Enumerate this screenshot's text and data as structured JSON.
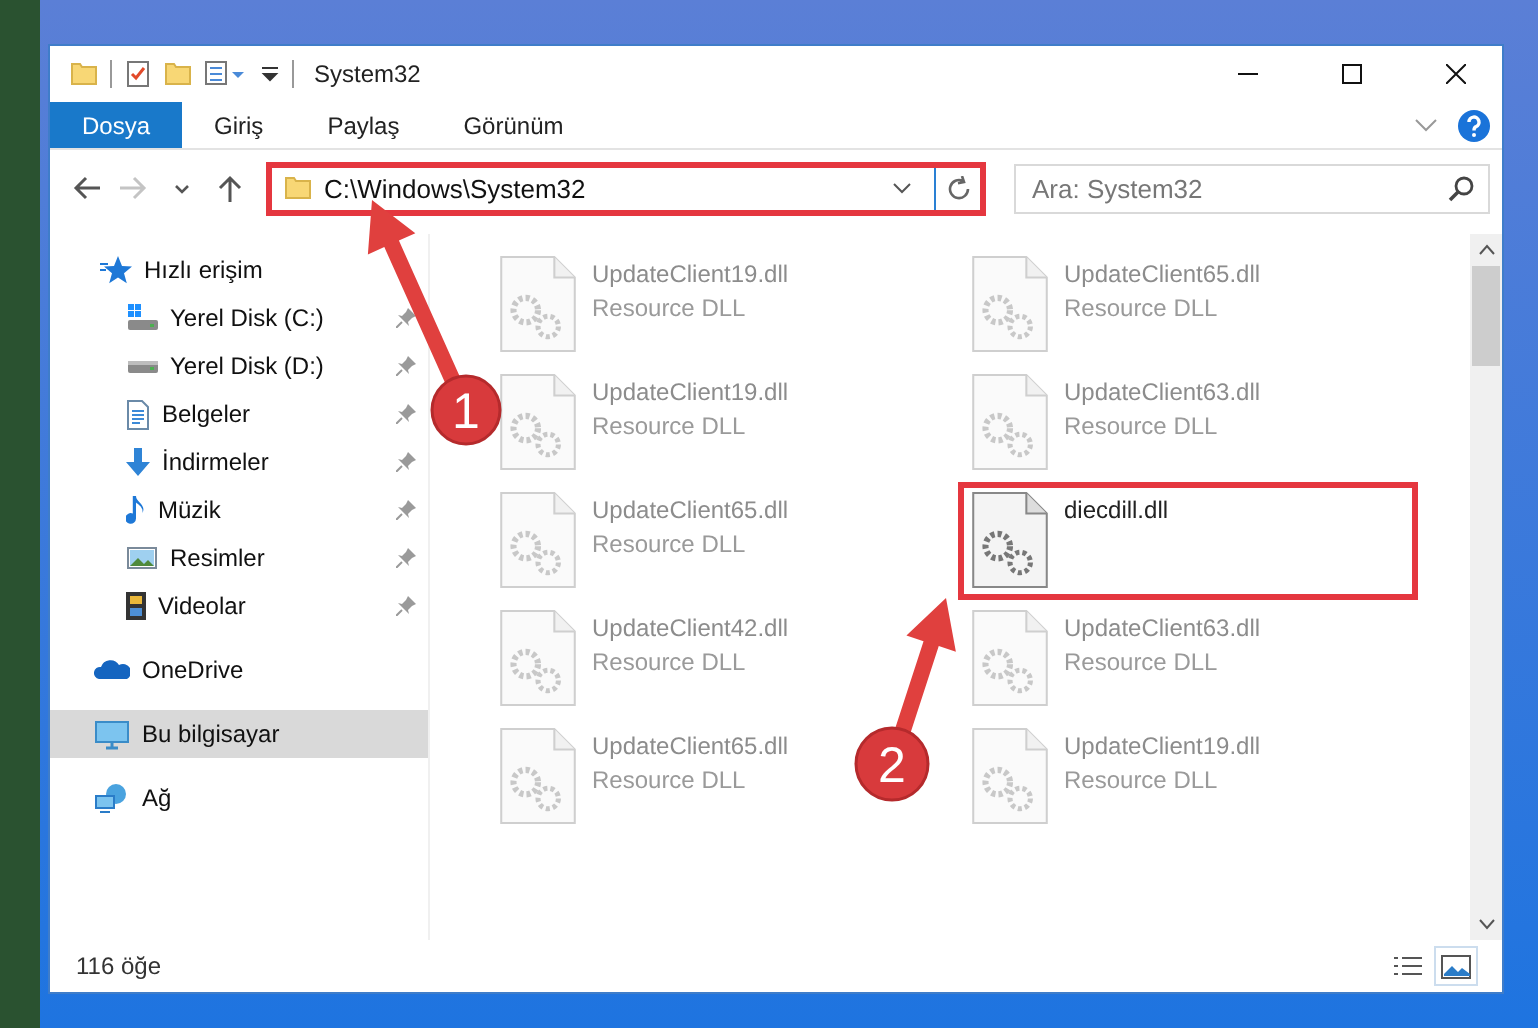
{
  "window": {
    "title": "System32"
  },
  "ribbon": {
    "tabs": [
      {
        "label": "Dosya",
        "selected": true
      },
      {
        "label": "Giriş",
        "selected": false
      },
      {
        "label": "Paylaş",
        "selected": false
      },
      {
        "label": "Görünüm",
        "selected": false
      }
    ]
  },
  "navigation": {
    "buttons": [
      {
        "kind": "back",
        "disabled": false
      },
      {
        "kind": "forward",
        "disabled": true
      },
      {
        "kind": "recent",
        "disabled": false
      },
      {
        "kind": "up",
        "disabled": false
      }
    ],
    "address": "C:\\Windows\\System32",
    "address_highlighted": true,
    "search": {
      "placeholder": "Ara: System32"
    }
  },
  "sidebar": {
    "items": [
      {
        "label": "Hızlı erişim",
        "kind": "star",
        "selected": false,
        "children": [
          {
            "label": "Yerel Disk (C:)",
            "kind": "system-drive",
            "pinned": true,
            "selected": false
          },
          {
            "label": "Yerel Disk (D:)",
            "kind": "drive",
            "pinned": true,
            "selected": false
          },
          {
            "label": "Belgeler",
            "kind": "documents",
            "pinned": true,
            "selected": false
          },
          {
            "label": "İndirmeler",
            "kind": "download",
            "pinned": true,
            "selected": false
          },
          {
            "label": "Müzik",
            "kind": "music",
            "pinned": true,
            "selected": false
          },
          {
            "label": "Resimler",
            "kind": "pictures",
            "pinned": true,
            "selected": false
          },
          {
            "label": "Videolar",
            "kind": "videos",
            "pinned": true,
            "selected": false
          }
        ]
      },
      {
        "label": "OneDrive",
        "kind": "cloud",
        "selected": false
      },
      {
        "label": "Bu bilgisayar",
        "kind": "computer",
        "selected": true
      },
      {
        "label": "Ağ",
        "kind": "network",
        "selected": false
      }
    ]
  },
  "files": [
    {
      "name": "UpdateClient19.dll",
      "type": "Resource DLL",
      "blurred": true,
      "highlighted": false
    },
    {
      "name": "UpdateClient65.dll",
      "type": "Resource DLL",
      "blurred": true,
      "highlighted": false
    },
    {
      "name": "UpdateClient19.dll",
      "type": "Resource DLL",
      "blurred": true,
      "highlighted": false
    },
    {
      "name": "UpdateClient63.dll",
      "type": "Resource DLL",
      "blurred": true,
      "highlighted": false
    },
    {
      "name": "UpdateClient65.dll",
      "type": "Resource DLL",
      "blurred": true,
      "highlighted": false
    },
    {
      "name": "diecdill.dll",
      "blurred": false,
      "highlighted": true
    },
    {
      "name": "UpdateClient42.dll",
      "type": "Resource DLL",
      "blurred": true,
      "highlighted": false
    },
    {
      "name": "UpdateClient63.dll",
      "type": "Resource DLL",
      "blurred": true,
      "highlighted": false
    },
    {
      "name": "UpdateClient65.dll",
      "type": "Resource DLL",
      "blurred": true,
      "highlighted": false
    },
    {
      "name": "UpdateClient19.dll",
      "type": "Resource DLL",
      "blurred": true,
      "highlighted": false
    }
  ],
  "status_bar": {
    "count": "116 öğe",
    "views": [
      {
        "kind": "details",
        "selected": false
      },
      {
        "kind": "tiles",
        "selected": true
      }
    ]
  },
  "annotations": [
    {
      "number": "1"
    },
    {
      "number": "2"
    }
  ]
}
